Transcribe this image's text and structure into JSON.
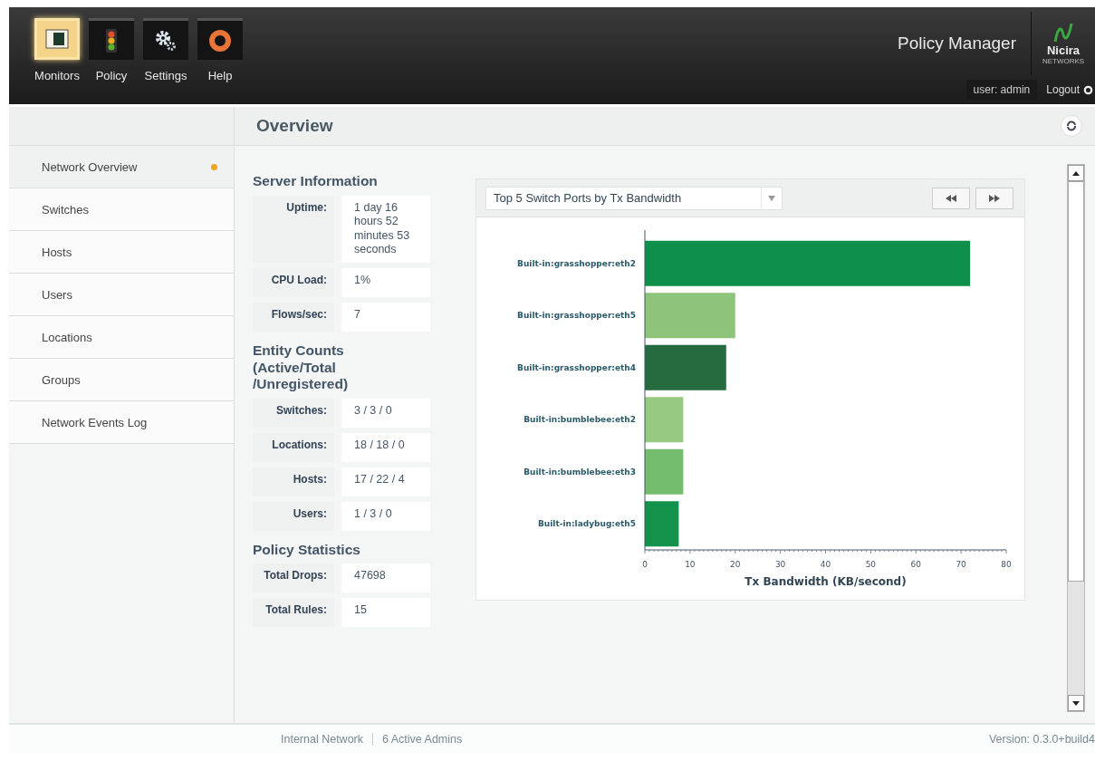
{
  "header": {
    "nav": [
      {
        "label": "Monitors",
        "selected": true
      },
      {
        "label": "Policy",
        "selected": false
      },
      {
        "label": "Settings",
        "selected": false
      },
      {
        "label": "Help",
        "selected": false
      }
    ],
    "app_title": "Policy Manager",
    "logo_text": "Nicira",
    "logo_subtext": "NETWORKS",
    "user": "user: admin",
    "logout": "Logout"
  },
  "sidebar": {
    "items": [
      {
        "label": "Network Overview",
        "selected": true
      },
      {
        "label": "Switches",
        "selected": false
      },
      {
        "label": "Hosts",
        "selected": false
      },
      {
        "label": "Users",
        "selected": false
      },
      {
        "label": "Locations",
        "selected": false
      },
      {
        "label": "Groups",
        "selected": false
      },
      {
        "label": "Network Events Log",
        "selected": false
      }
    ]
  },
  "page_title": "Overview",
  "sections": [
    {
      "title": "Server Information",
      "rows": [
        {
          "label": "Uptime:",
          "value": "1 day 16 hours 52 minutes 53 seconds"
        },
        {
          "label": "CPU Load:",
          "value": "1%"
        },
        {
          "label": "Flows/sec:",
          "value": "7"
        }
      ]
    },
    {
      "title": "Entity Counts (Active/Total /Unregistered)",
      "rows": [
        {
          "label": "Switches:",
          "value": "3 / 3 / 0"
        },
        {
          "label": "Locations:",
          "value": "18 / 18 / 0"
        },
        {
          "label": "Hosts:",
          "value": "17 / 22 / 4"
        },
        {
          "label": "Users:",
          "value": "1 / 3 / 0"
        }
      ]
    },
    {
      "title": "Policy Statistics",
      "rows": [
        {
          "label": "Total Drops:",
          "value": "47698"
        },
        {
          "label": "Total Rules:",
          "value": "15"
        }
      ]
    }
  ],
  "chart": {
    "dropdown": "Top 5 Switch Ports by Tx Bandwidth",
    "chart_data": {
      "type": "bar",
      "orientation": "horizontal",
      "xlabel": "Tx Bandwidth (KB/second)",
      "categories": [
        "Built-in:grasshopper:eth2",
        "Built-in:grasshopper:eth5",
        "Built-in:grasshopper:eth4",
        "Built-in:bumblebee:eth2",
        "Built-in:bumblebee:eth3",
        "Built-in:ladybug:eth5"
      ],
      "series": [
        {
          "colors": [
            "#0e8f4a",
            "#8dc47a",
            "#256b3f",
            "#98c980",
            "#74bd6e",
            "#12924b"
          ],
          "values": [
            72,
            20,
            18,
            8.5,
            8.5,
            7.5
          ]
        }
      ],
      "xlim": [
        0,
        80
      ],
      "xticks": [
        0,
        10,
        20,
        30,
        40,
        50,
        60,
        70,
        80
      ]
    }
  },
  "status_bar": {
    "items": [
      "Internal Network",
      "6 Active Admins"
    ],
    "version": "Version: 0.3.0+build4"
  }
}
